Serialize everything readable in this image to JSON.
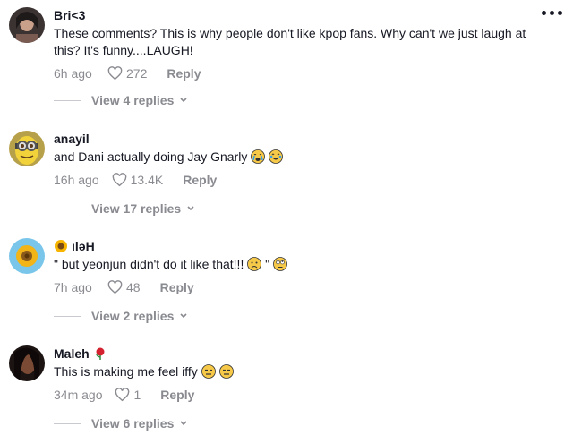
{
  "comments": [
    {
      "username": "Bri<3",
      "text": "These comments? This is why people don't like kpop fans. Why can't we just laugh at this? It's funny....LAUGH!",
      "time": "6h ago",
      "likes": "272",
      "reply_label": "Reply",
      "view_replies": "View 4 replies"
    },
    {
      "username": "anayil",
      "text": "and Dani actually doing Jay Gnarly",
      "time": "16h ago",
      "likes": "13.4K",
      "reply_label": "Reply",
      "view_replies": "View 17 replies"
    },
    {
      "username": "ıləH",
      "text_a": "\" but yeonjun didn't do it like that!!!",
      "text_b": "\"",
      "time": "7h ago",
      "likes": "48",
      "reply_label": "Reply",
      "view_replies": "View 2 replies"
    },
    {
      "username": "Maleh",
      "text": "This is making me feel iffy",
      "time": "34m ago",
      "likes": "1",
      "reply_label": "Reply",
      "view_replies": "View 6 replies"
    }
  ],
  "icons": {
    "more": "more-options-icon",
    "heart": "heart-outline-icon",
    "chevron": "chevron-down-icon"
  },
  "colors": {
    "text": "#161823",
    "muted": "#8a8b91"
  }
}
